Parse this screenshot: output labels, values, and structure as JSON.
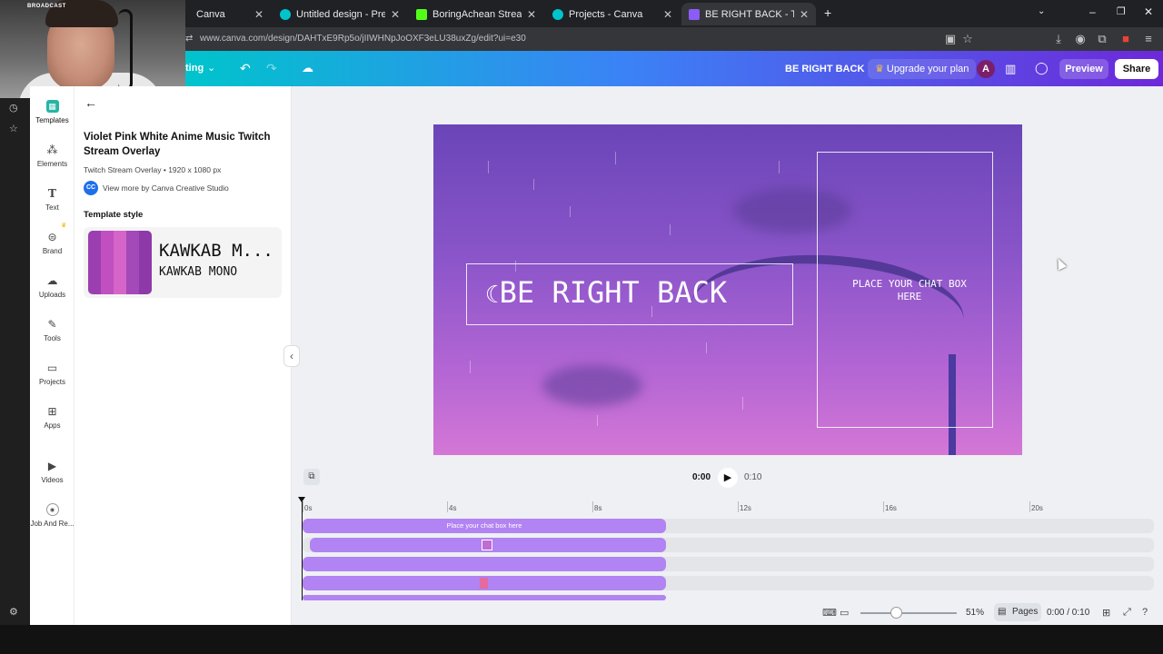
{
  "browser": {
    "tabs": [
      {
        "label": "Canva",
        "color": "#00c4cc"
      },
      {
        "label": "Untitled design - Presentation",
        "color": "#00c4cc"
      },
      {
        "label": "BoringAchean Stream - Kick Da",
        "color": "#53fc18"
      },
      {
        "label": "Projects - Canva",
        "color": "#00c4cc"
      },
      {
        "label": "BE RIGHT BACK - Twitch Stream",
        "color": "#8b5cf6"
      }
    ],
    "url": "www.canva.com/design/DAHTxE9Rp5o/jIIWHNpJoOXF3eLU38uxZg/edit?ui=e30"
  },
  "webcam": {
    "overlay_label": "BROADCAST"
  },
  "header": {
    "menu_label": "ting",
    "design_title": "BE RIGHT BACK",
    "upgrade_label": "Upgrade your plan",
    "avatar_initial": "A",
    "preview_label": "Preview",
    "share_label": "Share"
  },
  "rail": {
    "items": [
      {
        "label": "Templates"
      },
      {
        "label": "Elements"
      },
      {
        "label": "Text"
      },
      {
        "label": "Brand"
      },
      {
        "label": "Uploads"
      },
      {
        "label": "Tools"
      },
      {
        "label": "Projects"
      },
      {
        "label": "Apps"
      },
      {
        "label": "Videos"
      },
      {
        "label": "Job And Re..."
      }
    ]
  },
  "panel": {
    "title": "Violet Pink White Anime Music Twitch Stream Overlay",
    "subtitle": "Twitch Stream Overlay • 1920 x 1080 px",
    "creator_badge": "CC",
    "creator_link": "View more by Canva Creative Studio",
    "style_heading": "Template style",
    "font_main": "KAWKAB M...",
    "font_sub": "KAWKAB MONO",
    "swatch_colors": [
      "#9b3fb0",
      "#c14fc0",
      "#d565c8",
      "#a349b8",
      "#8d3aa8"
    ]
  },
  "canvas": {
    "headline": "BE RIGHT BACK",
    "chat_placeholder": "PLACE YOUR CHAT BOX HERE"
  },
  "playback": {
    "current": "0:00",
    "total": "0:10"
  },
  "timeline": {
    "ticks": [
      "0s",
      "4s",
      "8s",
      "12s",
      "16s",
      "20s"
    ],
    "track_label": "Place your chat box here"
  },
  "footer": {
    "zoom": "51%",
    "zoom_fraction": 0.37,
    "pages_label": "Pages",
    "time": "0:00 / 0:10"
  }
}
